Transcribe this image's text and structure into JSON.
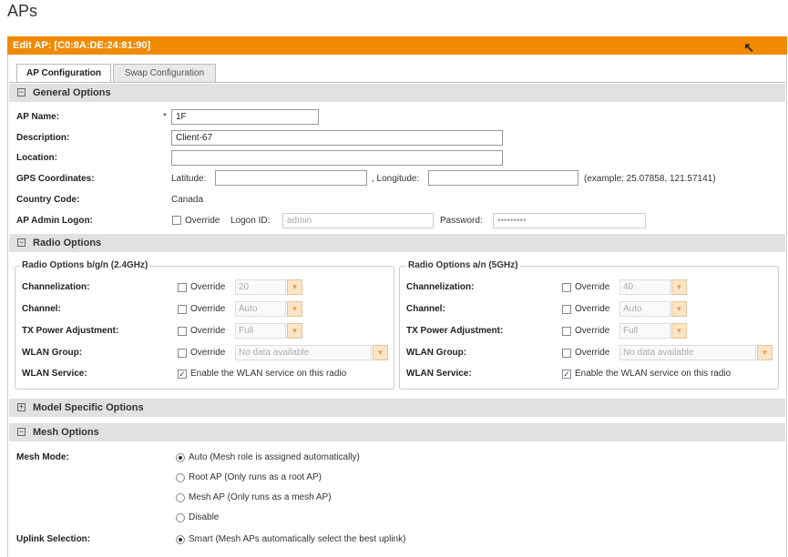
{
  "page_title": "APs",
  "edit_bar": {
    "title": "Edit AP: [C0:8A:DE:24:81:90]"
  },
  "tabs": [
    {
      "label": "AP Configuration",
      "active": true
    },
    {
      "label": "Swap Configuration",
      "active": false
    }
  ],
  "general": {
    "header": "General Options",
    "ap_name": {
      "label": "AP Name:",
      "required": "*",
      "value": "1F"
    },
    "description": {
      "label": "Description:",
      "value": "Client-67"
    },
    "location": {
      "label": "Location:",
      "value": ""
    },
    "gps": {
      "label": "GPS Coordinates:",
      "latitude_label": "Latitude:",
      "longitude_label": ", Longitude:",
      "latitude": "",
      "longitude": "",
      "example": "(example: 25.07858, 121.57141)"
    },
    "country": {
      "label": "Country Code:",
      "value": "Canada"
    },
    "admin": {
      "label": "AP Admin Logon:",
      "override": "Override",
      "logon_label": "Logon ID:",
      "logon_value": "admin",
      "password_label": "Password:",
      "password_value": "•••••••••"
    }
  },
  "radio": {
    "header": "Radio Options",
    "bgn": {
      "legend": "Radio Options b/g/n (2.4GHz)",
      "rows": [
        {
          "label": "Channelization:",
          "override": "Override",
          "value": "20"
        },
        {
          "label": "Channel:",
          "override": "Override",
          "value": "Auto"
        },
        {
          "label": "TX Power Adjustment:",
          "override": "Override",
          "value": "Full"
        },
        {
          "label": "WLAN Group:",
          "override": "Override",
          "value": "No data available"
        }
      ],
      "service": {
        "label": "WLAN Service:",
        "text": "Enable the WLAN service on this radio",
        "checked": true
      }
    },
    "an": {
      "legend": "Radio Options a/n (5GHz)",
      "rows": [
        {
          "label": "Channelization:",
          "override": "Override",
          "value": "40"
        },
        {
          "label": "Channel:",
          "override": "Override",
          "value": "Auto"
        },
        {
          "label": "TX Power Adjustment:",
          "override": "Override",
          "value": "Full"
        },
        {
          "label": "WLAN Group:",
          "override": "Override",
          "value": "No data available"
        }
      ],
      "service": {
        "label": "WLAN Service:",
        "text": "Enable the WLAN service on this radio",
        "checked": true
      }
    }
  },
  "model": {
    "header": "Model Specific Options"
  },
  "mesh": {
    "header": "Mesh Options",
    "mode_label": "Mesh Mode:",
    "modes": [
      {
        "label": "Auto (Mesh role is assigned automatically)",
        "selected": true
      },
      {
        "label": "Root AP (Only runs as a root AP)",
        "selected": false
      },
      {
        "label": "Mesh AP (Only runs as a mesh AP)",
        "selected": false
      },
      {
        "label": "Disable",
        "selected": false
      }
    ],
    "uplink_label": "Uplink Selection:",
    "uplink": {
      "label": "Smart (Mesh APs automatically select the best uplink)",
      "selected": true
    }
  },
  "icons": {
    "expanded": "minus-box-icon",
    "collapsed": "plus-box-icon",
    "cursor": "mouse-pointer-icon",
    "dropdown": "chevron-down-icon",
    "check": "checkmark-icon"
  },
  "colors": {
    "header_bar": "#f08a00",
    "section_bg": "#e1e1e1",
    "dropdown_button": "#fce5c6"
  }
}
